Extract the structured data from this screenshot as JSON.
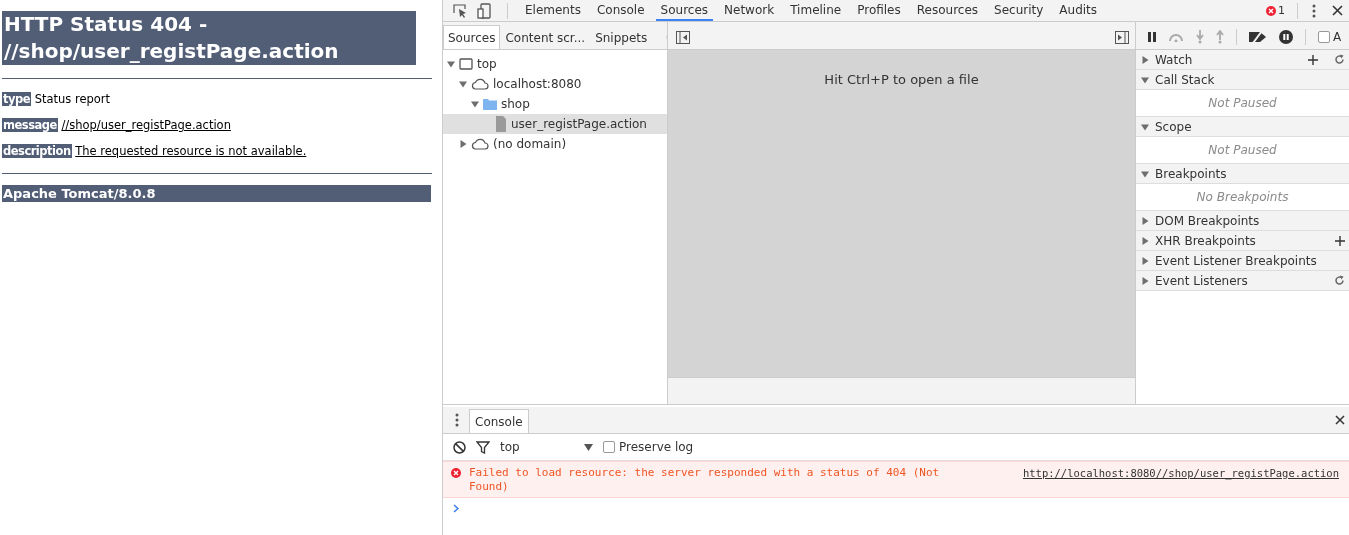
{
  "page": {
    "title": "HTTP Status 404 - //shop/user_registPage.action",
    "fields": [
      {
        "label": "type",
        "value": "Status report",
        "kind": "text"
      },
      {
        "label": "message",
        "value": "//shop/user_registPage.action",
        "kind": "link"
      },
      {
        "label": "description",
        "value": "The requested resource is not available.",
        "kind": "link"
      }
    ],
    "footer": "Apache Tomcat/8.0.8"
  },
  "devtools": {
    "tabs": [
      {
        "label": "Elements",
        "selected": false
      },
      {
        "label": "Console",
        "selected": false
      },
      {
        "label": "Sources",
        "selected": true
      },
      {
        "label": "Network",
        "selected": false
      },
      {
        "label": "Timeline",
        "selected": false
      },
      {
        "label": "Profiles",
        "selected": false
      },
      {
        "label": "Resources",
        "selected": false
      },
      {
        "label": "Security",
        "selected": false
      },
      {
        "label": "Audits",
        "selected": false
      }
    ],
    "error_count": "1",
    "navigator": {
      "tabs": [
        {
          "label": "Sources",
          "selected": true
        },
        {
          "label": "Content scr...",
          "selected": false
        },
        {
          "label": "Snippets",
          "selected": false
        }
      ],
      "tree": [
        {
          "label": "top",
          "kind": "frame",
          "expanded": true,
          "selected": false,
          "children": [
            {
              "label": "localhost:8080",
              "kind": "domain",
              "expanded": true,
              "selected": false,
              "children": [
                {
                  "label": "shop",
                  "kind": "folder",
                  "expanded": true,
                  "selected": false,
                  "children": [
                    {
                      "label": "user_registPage.action",
                      "kind": "file",
                      "selected": true
                    }
                  ]
                }
              ]
            },
            {
              "label": "(no domain)",
              "kind": "domain",
              "expanded": false,
              "selected": false
            }
          ]
        }
      ]
    },
    "editor": {
      "hint": "Hit Ctrl+P to open a file"
    },
    "debugger": {
      "async_checkbox": {
        "label": "A",
        "checked": false
      },
      "sections": [
        {
          "title": "Watch",
          "expanded": false,
          "add_button": true,
          "refresh_button": true
        },
        {
          "title": "Call Stack",
          "expanded": true,
          "body": "Not Paused"
        },
        {
          "title": "Scope",
          "expanded": true,
          "body": "Not Paused"
        },
        {
          "title": "Breakpoints",
          "expanded": true,
          "body": "No Breakpoints"
        },
        {
          "title": "DOM Breakpoints",
          "expanded": false
        },
        {
          "title": "XHR Breakpoints",
          "expanded": false,
          "add_button": true
        },
        {
          "title": "Event Listener Breakpoints",
          "expanded": false
        },
        {
          "title": "Event Listeners",
          "expanded": false,
          "refresh_button": true
        }
      ]
    },
    "console": {
      "tab": {
        "label": "Console",
        "selected": true
      },
      "context": "top",
      "preserve_log": {
        "label": "Preserve log",
        "checked": false
      },
      "messages": [
        {
          "kind": "error",
          "text": "Failed to load resource: the server responded with a status of 404 (Not Found)",
          "url": "http://localhost:8080//shop/user_registPage.action"
        }
      ]
    }
  }
}
